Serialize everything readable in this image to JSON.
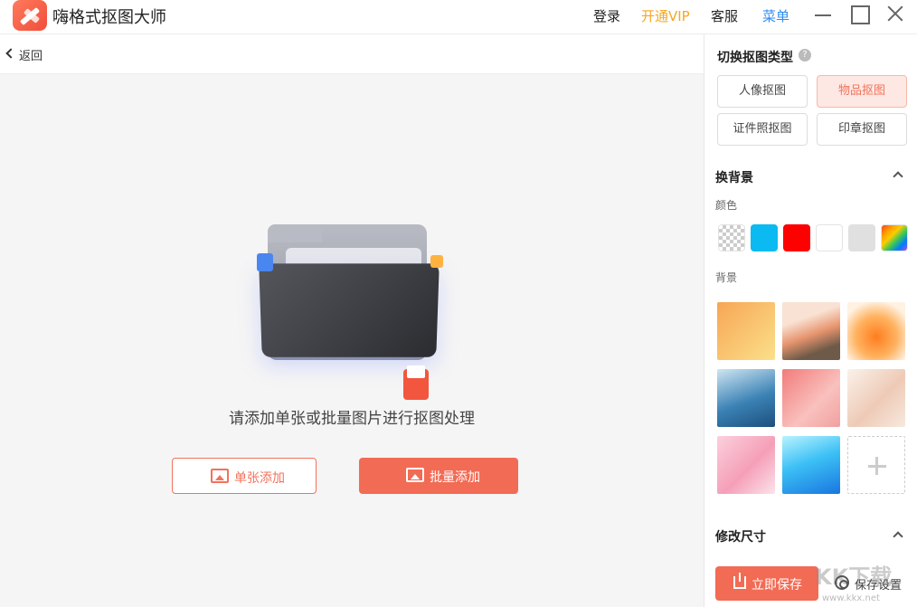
{
  "app": {
    "title": "嗨格式抠图大师"
  },
  "top_nav": {
    "login": "登录",
    "vip": "开通VIP",
    "service": "客服",
    "menu": "菜单"
  },
  "main": {
    "back_label": "返回",
    "prompt": "请添加单张或批量图片进行抠图处理",
    "single_add_label": "单张添加",
    "batch_add_label": "批量添加"
  },
  "panel": {
    "switch_type_title": "切换抠图类型",
    "types": [
      {
        "label": "人像抠图",
        "active": false
      },
      {
        "label": "物品抠图",
        "active": true
      },
      {
        "label": "证件照抠图",
        "active": false
      },
      {
        "label": "印章抠图",
        "active": false
      }
    ],
    "change_bg_title": "换背景",
    "color_label": "颜色",
    "colors": [
      {
        "name": "transparent",
        "hex": "transparent"
      },
      {
        "name": "sky-blue",
        "hex": "#0bbaf0"
      },
      {
        "name": "red",
        "hex": "#ff0000"
      },
      {
        "name": "white",
        "hex": "#ffffff"
      },
      {
        "name": "light-gray",
        "hex": "#e0e0e0"
      },
      {
        "name": "rainbow",
        "hex": "gradient"
      }
    ],
    "background_label": "背景",
    "backgrounds": [
      {
        "name": "orange-yellow-texture",
        "hex": "#f9c26a"
      },
      {
        "name": "orange-crystal",
        "hex": "#e9a07a"
      },
      {
        "name": "orange-glow",
        "hex": "#ff9a3c"
      },
      {
        "name": "blue-waves",
        "hex": "#3f88b8"
      },
      {
        "name": "pink-texture",
        "hex": "#f08a8a"
      },
      {
        "name": "cream-silk",
        "hex": "#f2ddd0"
      },
      {
        "name": "pink-soft",
        "hex": "#f7b6c8"
      },
      {
        "name": "blue-gradient",
        "hex": "#3fb7f0"
      }
    ],
    "resize_title": "修改尺寸",
    "save_now_label": "立即保存",
    "save_settings_label": "保存设置",
    "watermark_text": "KK下载",
    "watermark_url": "www.kkx.net"
  }
}
